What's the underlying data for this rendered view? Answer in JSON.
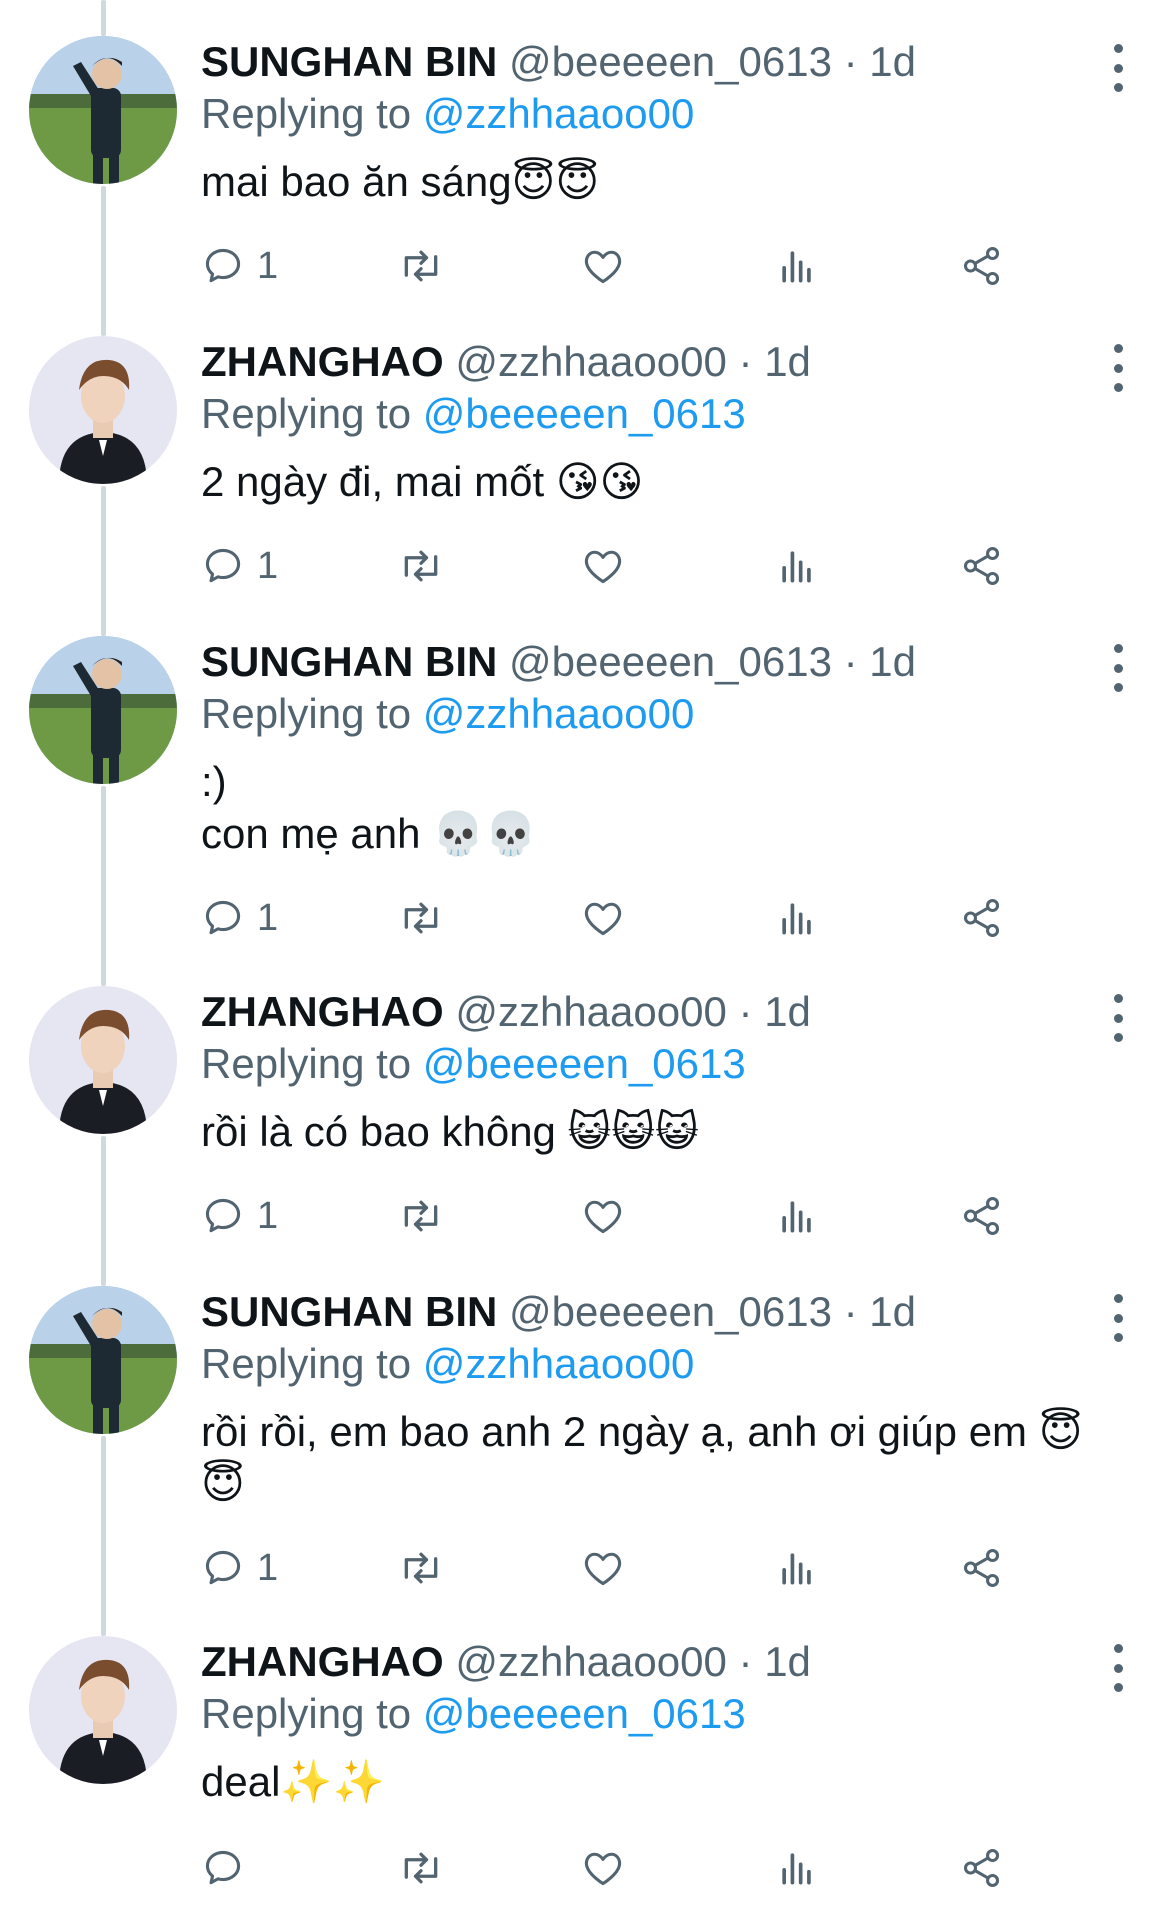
{
  "colors": {
    "text": "#0f1419",
    "secondary": "#536471",
    "mention": "#1d9bf0",
    "thread_line": "#cfd9de"
  },
  "tweets": [
    {
      "name": "SUNGHAN BIN",
      "handle": "@beeeeen_0613",
      "separator": "·",
      "time": "1d",
      "replying_label": "Replying to",
      "replying_to": "@zzhhaaoo00",
      "lines": [
        "mai bao ăn sáng😇😇"
      ],
      "reply_count": "1",
      "avatar": "sunghan-avatar"
    },
    {
      "name": "ZHANGHAO",
      "handle": "@zzhhaaoo00",
      "separator": "·",
      "time": "1d",
      "replying_label": "Replying to",
      "replying_to": "@beeeeen_0613",
      "lines": [
        "2 ngày đi, mai mốt 😘😘"
      ],
      "reply_count": "1",
      "avatar": "zhanghao-avatar"
    },
    {
      "name": "SUNGHAN BIN",
      "handle": "@beeeeen_0613",
      "separator": "·",
      "time": "1d",
      "replying_label": "Replying to",
      "replying_to": "@zzhhaaoo00",
      "lines": [
        ":)",
        "con mẹ anh 💀💀"
      ],
      "reply_count": "1",
      "avatar": "sunghan-avatar"
    },
    {
      "name": "ZHANGHAO",
      "handle": "@zzhhaaoo00",
      "separator": "·",
      "time": "1d",
      "replying_label": "Replying to",
      "replying_to": "@beeeeen_0613",
      "lines": [
        "rồi là có bao không 😺😺😺"
      ],
      "reply_count": "1",
      "avatar": "zhanghao-avatar"
    },
    {
      "name": "SUNGHAN BIN",
      "handle": "@beeeeen_0613",
      "separator": "·",
      "time": "1d",
      "replying_label": "Replying to",
      "replying_to": "@zzhhaaoo00",
      "lines": [
        "rồi rồi, em bao anh 2 ngày ạ, anh ơi giúp em 😇",
        "😇"
      ],
      "reply_count": "1",
      "avatar": "sunghan-avatar"
    },
    {
      "name": "ZHANGHAO",
      "handle": "@zzhhaaoo00",
      "separator": "·",
      "time": "1d",
      "replying_label": "Replying to",
      "replying_to": "@beeeeen_0613",
      "lines": [
        "deal✨✨"
      ],
      "reply_count": "",
      "avatar": "zhanghao-avatar"
    }
  ]
}
